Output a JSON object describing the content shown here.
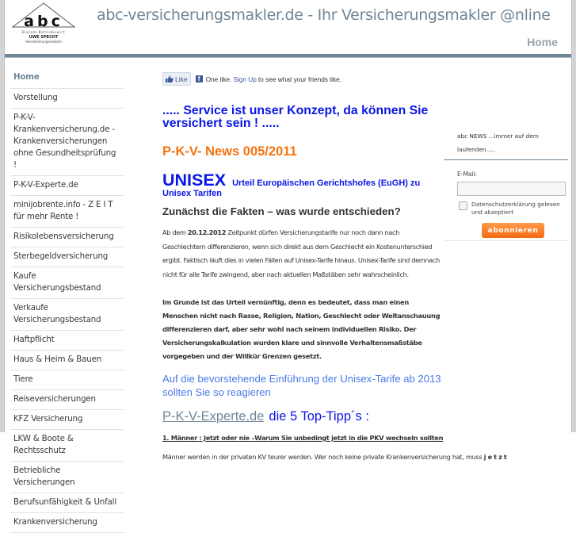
{
  "header": {
    "logo": {
      "letters": "abc",
      "line1": "Diplom-Betriebswirt",
      "line2": "UWE SPECHT",
      "line3": "-Versicherungsmakler-"
    },
    "site_title": "abc-versicherungsmakler.de - Ihr Versicherungsmakler @nline",
    "nav": {
      "home": "Home"
    }
  },
  "sidebar": {
    "items": [
      {
        "label": "Home",
        "active": true
      },
      {
        "label": "Vorstellung"
      },
      {
        "label": "P-K-V-Krankenversicherung.de - Krankenversicherungen ohne Gesundheitsprüfung !"
      },
      {
        "label": "P-K-V-Experte.de"
      },
      {
        "label": "minijobrente.info - Z E I T für mehr Rente !"
      },
      {
        "label": "Risikolebensversicherung"
      },
      {
        "label": "Sterbegeldversicherung"
      },
      {
        "label": "Kaufe Versicherungsbestand"
      },
      {
        "label": "Verkaufe Versicherungsbestand"
      },
      {
        "label": "Haftpflicht"
      },
      {
        "label": "Haus & Heim & Bauen"
      },
      {
        "label": "Tiere"
      },
      {
        "label": "Reiseversicherungen"
      },
      {
        "label": "KFZ Versicherung"
      },
      {
        "label": "LKW & Boote & Rechtsschutz"
      },
      {
        "label": "Betriebliche Versicherungen"
      },
      {
        "label": "Berufsunfähigkeit & Unfall"
      },
      {
        "label": "Krankenversicherung"
      }
    ]
  },
  "facebook": {
    "like_label": "Like",
    "fb_glyph": "f",
    "count_text": "One like.",
    "signup_link": "Sign Up",
    "suffix_text": "to see what your friends like."
  },
  "main": {
    "slogan": "..... Service ist unser Konzept, da können Sie versichert sein ! .....",
    "news_heading": "P-K-V- News 005/2011",
    "unisex_title": "UNISEX",
    "unisex_subtitle": "Urteil Europäischen Gerichtshofes (EuGH) zu Unisex Tarifen",
    "facts_heading": "Zunächst die Fakten – was wurde entschieden?",
    "para1_prefix": "Ab dem ",
    "para1_date": "20.12.2012",
    "para1_rest": " Zeitpunkt dürfen Versicherungstarife nur noch dann nach Geschlechtern differenzieren, wenn sich direkt aus dem Geschlecht ein Kostenunterschied ergibt. Faktisch läuft dies in vielen Fällen auf Unisex-Tarife hinaus. Unisex-Tarife sind demnach nicht für alle Tarife zwingend, aber nach aktuellen Maßstäben sehr wahrscheinlich.",
    "para2": "Im Grunde ist das Urteil vernünftig, denn es bedeutet, dass man einen Menschen nicht nach Rasse, Religion, Nation, Geschlecht oder Weltanschauung differenzieren darf, aber sehr wohl nach seinem individuellen Risiko. Der Versicherungskalkulation wurden klare und sinnvolle Verhaltensmaßstäbe vorgegeben und der Willkür Grenzen gesetzt.",
    "notice": "Auf die bevorstehende Einführung der Unisex-Tarife ab 2013 sollten Sie so reagieren",
    "tips_link": "P-K-V-Experte.de",
    "tips_text": "die 5 Top-Tipp´s :",
    "dot": ".",
    "tip1_heading": "1. Männer : Jetzt oder nie –Warum Sie unbedingt jetzt in die PKV wechseln sollten",
    "tip1_text": "Männer werden in der privaten KV teurer werden. Wer noch keine private Krankenversicherung hat, muss ",
    "tip1_emphasis": "jetzt"
  },
  "newsletter": {
    "title": "abc NEWS ...immer auf dem laufenden.....",
    "email_label": "E-Mail:",
    "email_value": "",
    "email_placeholder": "",
    "consent_label": "Datenschutzerklärung gelesen und akzeptiert",
    "consent_checked": false,
    "subscribe_label": "abonnieren"
  },
  "colors": {
    "accent_blue": "#0a17e6",
    "accent_orange": "#f5730f",
    "header_gray_blue": "#6f8796",
    "facebook_blue": "#3b5998",
    "notice_blue": "#4a7ae8"
  }
}
